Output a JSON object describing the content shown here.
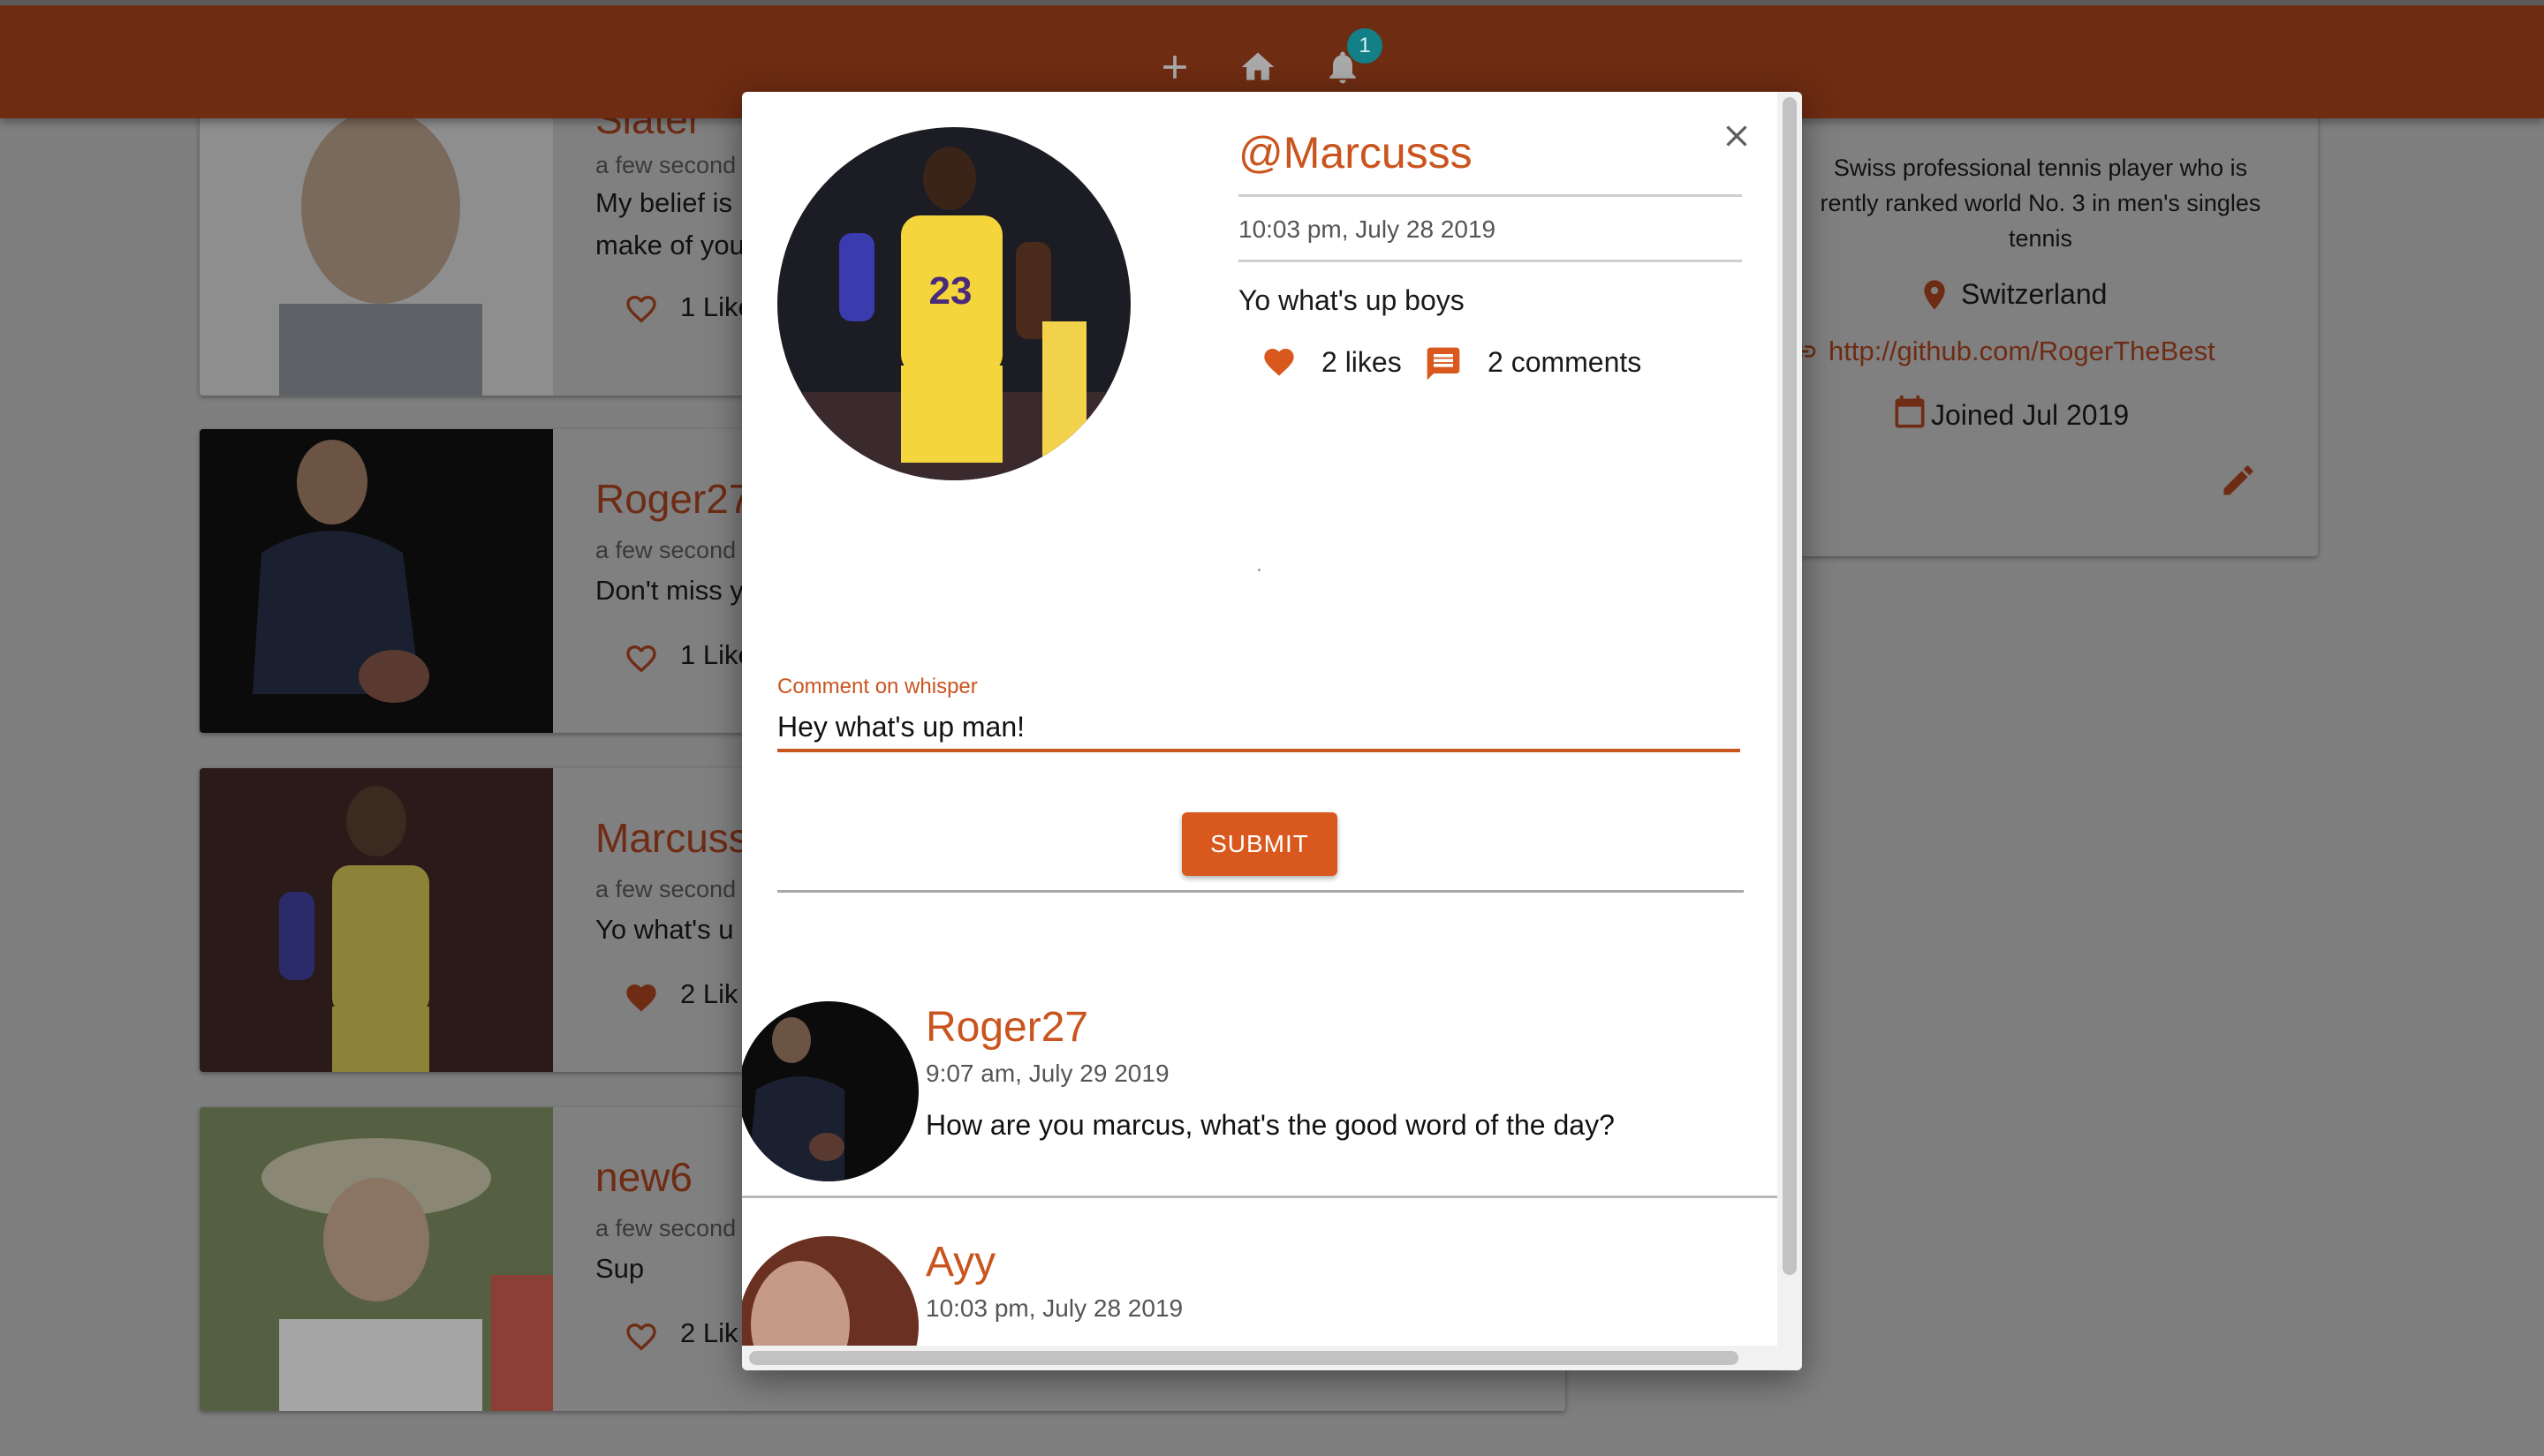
{
  "header": {
    "badge_count": "1",
    "icons": [
      "plus-icon",
      "home-icon",
      "bell-icon"
    ]
  },
  "feed": {
    "items": [
      {
        "name": "Slater",
        "time": "a few second",
        "body": "My belief is",
        "body2": "make of you",
        "likes": "1 Like"
      },
      {
        "name": "Roger27",
        "time": "a few second",
        "body": "Don't miss y",
        "likes": "1 Like"
      },
      {
        "name": "Marcuss",
        "time": "a few second",
        "body": "Yo what's u",
        "likes": "2 Lik"
      },
      {
        "name": "new6",
        "time": "a few second",
        "body": "Sup",
        "likes": "2 Lik"
      }
    ]
  },
  "profile": {
    "bio_line1": "Swiss professional tennis player who is",
    "bio_line2": "rently ranked world No. 3 in men's singles",
    "bio_line3": "tennis",
    "location": "Switzerland",
    "website": "http://github.com/RogerTheBest",
    "joined": "Joined Jul 2019"
  },
  "modal": {
    "handle": "@Marcusss",
    "timestamp": "10:03 pm, July 28 2019",
    "body": "Yo what's up boys",
    "likes": "2 likes",
    "comments": "2 comments",
    "comment_field": {
      "label": "Comment on whisper",
      "value": "Hey what's up man!"
    },
    "submit_label": "SUBMIT",
    "comment_list": [
      {
        "name": "Roger27",
        "time": "9:07 am, July 29 2019",
        "body": "How are you marcus, what's the good word of the day?"
      },
      {
        "name": "Ayy",
        "time": "10:03 pm, July 28 2019",
        "body": ""
      }
    ]
  },
  "colors": {
    "appbar": "#6e2c12",
    "accent": "#c9541e",
    "submit": "#d8581e",
    "badge": "#137f86"
  }
}
